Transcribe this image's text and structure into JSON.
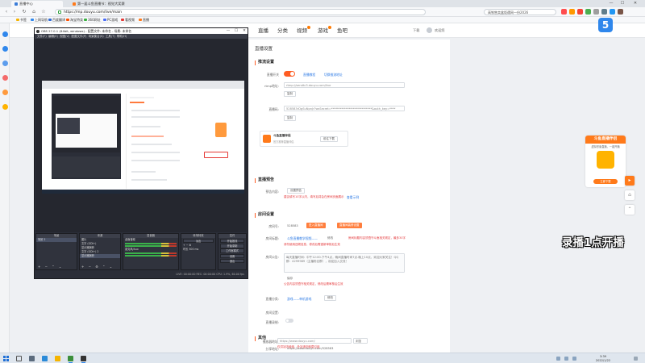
{
  "browser": {
    "tabs": [
      {
        "title": "直播中心",
        "active": true
      },
      {
        "title": "第一届斗鱼直播节：视觉大奖赛",
        "active": false
      }
    ],
    "url": "https://mp.douyu.com/live/main",
    "search_text": "高铁售卖盒饭遭网一份2026",
    "bookmarks": [
      "书签",
      "上网导航",
      "百度翻译",
      "淘宝特卖",
      "360网址",
      "PC游戏",
      "看视频",
      "直播"
    ]
  },
  "site": {
    "nav_items": [
      "直播",
      "分类",
      "视频",
      "游戏",
      "鱼吧"
    ],
    "nav_right": [
      "下载",
      "欢迎您"
    ],
    "logo_text": "5"
  },
  "panel": {
    "title": "直播设置",
    "push": {
      "section": "推流设置",
      "toggle_label": "直播开关",
      "links": [
        "直播教程",
        "切换推流地址"
      ],
      "rtmp_label": "rtmp地址:",
      "rtmp_value": "rtmp://sendtc3.douyu.com/live",
      "copy1": "复制",
      "code_label": "直播码:",
      "code_value": "528583rDgSuNpnJr?wsSecret=****************************&auth_key=****",
      "copy2": "复制"
    },
    "tool": {
      "name": "斗鱼直播伴侣",
      "desc": "官方推荐直播伴侣",
      "button": "前往下载"
    },
    "preview": {
      "section": "直播预告",
      "label": "预告内容:",
      "button": "设置预告",
      "note": "建议填写10字以内，填写后将会在房间页面展示",
      "link": "查看示例"
    },
    "room": {
      "section": "房间设置",
      "id_label": "房间号:",
      "id_value": "528583",
      "btn_a": "进入直播间",
      "btn_b": "直播间装修设置",
      "name_label": "房间标题:",
      "name_value": "斗鱼直播教学视频——",
      "edit": "修改",
      "name_tip": "房间标题内容须遵守斗鱼相关规定，最多30字",
      "name_note": "请勿使用违规信息，修改后需重新审核后生效",
      "notice_label": "房间公告:",
      "notice_text": "每天直播时间：中午12:00-下午4点，晚间直播时间7点-晚上10点，欢迎大家关注！QQ群：4299989（主播粉丝群），欢迎加入交流！",
      "save": "保存",
      "notice_tip": "公告内容须遵守相关规定，修改后需审核后生效",
      "category_label": "直播分类:",
      "category_value": "游戏——单机游戏",
      "change": "修改",
      "setting_label": "房间设置:",
      "private_label": "直播录制:"
    },
    "other": {
      "section": "其他",
      "share_label": "分享地址:",
      "share_value": "https://www.douyu.com/528583",
      "player_label": "播放器地址:",
      "player_value": "https://www.douyu.com/",
      "select": "浏览",
      "note": "仅供站内使用，外站请勿转载引用"
    }
  },
  "promo": {
    "title": "斗鱼直播伴侣",
    "subtitle": "虚拟形象直播，一键开播",
    "button": "立即下载"
  },
  "overlay": "录播1点开播",
  "obs": {
    "title": "OBS 27.0.1 (64bit, windows) - 配置文件: 未命名 - 场景: 未命名",
    "menu": [
      "文件(F)",
      "编辑(E)",
      "视图(V)",
      "配置文件(P)",
      "场景集合(S)",
      "工具(T)",
      "帮助(H)"
    ],
    "docks": {
      "scenes": {
        "title": "场景",
        "items": [
          "场景 2"
        ]
      },
      "sources": {
        "title": "来源",
        "items": [
          "图片",
          "文字 (GDI+)",
          "显示器捕获",
          "文字 (GDI+) 2",
          "显示器捕获"
        ]
      },
      "mixer": {
        "title": "混音器",
        "items": [
          "桌面音频",
          "麦克风/Aux"
        ]
      },
      "transitions": {
        "title": "转场特效",
        "items": [
          "淡出",
          "时长",
          "300 ms"
        ]
      },
      "controls": {
        "title": "控件",
        "items": [
          "开始推流",
          "开始录制",
          "工作室模式",
          "设置",
          "退出"
        ]
      }
    },
    "status": "LIVE: 00:00:00    REC: 00:00:00    CPU: 1.9%, 60.00 fps"
  },
  "taskbar": {
    "time": "3:39",
    "date": "2022/1/22"
  },
  "colors": {
    "accent": "#ff5d23",
    "orange": "#ff7a1a",
    "link": "#2d7ae5",
    "error": "#e4393c"
  }
}
